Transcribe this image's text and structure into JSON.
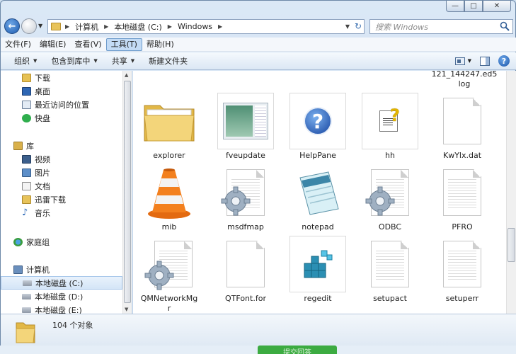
{
  "window": {
    "caption_buttons": {
      "minimize": "—",
      "maximize": "□",
      "close": "✕"
    }
  },
  "address": {
    "crumbs": [
      "计算机",
      "本地磁盘 (C:)",
      "Windows"
    ],
    "search_placeholder": "搜索 Windows"
  },
  "menu": [
    "文件(F)",
    "编辑(E)",
    "查看(V)",
    "工具(T)",
    "帮助(H)"
  ],
  "menu_active_index": 3,
  "commands": {
    "organize": "组织",
    "include_in_library": "包含到库中",
    "share": "共享",
    "new_folder": "新建文件夹"
  },
  "nav": {
    "downloads": "下载",
    "desktop": "桌面",
    "recent": "最近访问的位置",
    "kuaipan": "快盘",
    "libraries": "库",
    "videos": "视频",
    "pictures": "图片",
    "documents": "文档",
    "thunder": "迅雷下载",
    "music": "音乐",
    "homegroup": "家庭组",
    "computer": "计算机",
    "drive_c": "本地磁盘 (C:)",
    "drive_d": "本地磁盘 (D:)",
    "drive_e": "本地磁盘 (E:)"
  },
  "files": {
    "partial_top": "121_144247.ed5\nlog",
    "explorer": "explorer",
    "fveupdate": "fveupdate",
    "helppane": "HelpPane",
    "hh": "hh",
    "kwylx": "KwYlx.dat",
    "mib": "mib",
    "msdfmap": "msdfmap",
    "notepad": "notepad",
    "odbc": "ODBC",
    "pfro": "PFRO",
    "qmnetwork": "QMNetworkMg\nr",
    "qtfont": "QTFont.for",
    "regedit": "regedit",
    "setupact": "setupact",
    "setuperr": "setuperr"
  },
  "status": {
    "count": "104 个对象"
  },
  "background_button": "提交回答"
}
